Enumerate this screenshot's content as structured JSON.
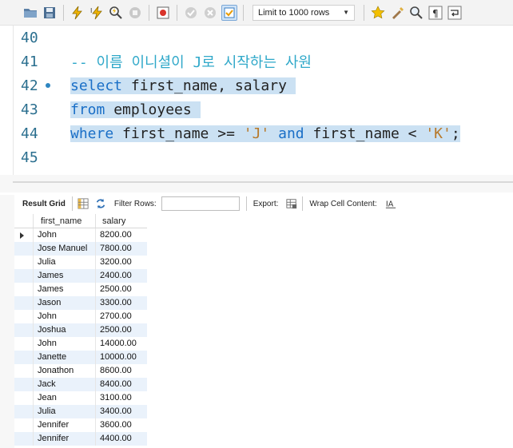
{
  "toolbar": {
    "limit_label": "Limit to 1000 rows",
    "icons": [
      "open-folder-icon",
      "save-icon",
      "execute-icon",
      "execute-current-icon",
      "explain-icon",
      "stop-icon",
      "toggle-error-icon",
      "commit-icon",
      "rollback-icon",
      "autocommit-icon",
      "bookmark-star-icon",
      "beautify-brush-icon",
      "find-icon",
      "invisible-chars-icon",
      "wrap-icon"
    ]
  },
  "editor": {
    "lines": [
      {
        "num": "40"
      },
      {
        "num": "41",
        "comment": "-- 이름 이니셜이 J로 시작하는 사원"
      },
      {
        "num": "42",
        "kw1": "select",
        "rest": " first_name, salary "
      },
      {
        "num": "43",
        "kw1": "from",
        "rest": " employees "
      },
      {
        "num": "44",
        "kw1": "where",
        "a": " first_name >= ",
        "s1": "'J'",
        "kw2": "and",
        "b": " first_name < ",
        "s2": "'K'",
        "c": ";"
      },
      {
        "num": "45"
      }
    ]
  },
  "result_toolbar": {
    "result_grid": "Result Grid",
    "filter_rows": "Filter Rows:",
    "filter_value": "",
    "export": "Export:",
    "wrap": "Wrap Cell Content:"
  },
  "grid": {
    "columns": [
      "first_name",
      "salary"
    ],
    "rows": [
      [
        "John",
        "8200.00"
      ],
      [
        "Jose Manuel",
        "7800.00"
      ],
      [
        "Julia",
        "3200.00"
      ],
      [
        "James",
        "2400.00"
      ],
      [
        "James",
        "2500.00"
      ],
      [
        "Jason",
        "3300.00"
      ],
      [
        "John",
        "2700.00"
      ],
      [
        "Joshua",
        "2500.00"
      ],
      [
        "John",
        "14000.00"
      ],
      [
        "Janette",
        "10000.00"
      ],
      [
        "Jonathon",
        "8600.00"
      ],
      [
        "Jack",
        "8400.00"
      ],
      [
        "Jean",
        "3100.00"
      ],
      [
        "Julia",
        "3400.00"
      ],
      [
        "Jennifer",
        "3600.00"
      ],
      [
        "Jennifer",
        "4400.00"
      ]
    ]
  },
  "colors": {
    "keyword": "#1a6fc7",
    "string": "#b7792b",
    "comment": "#2fa8c9",
    "selection": "#cbe1f3",
    "row_alt": "#eaf2fb"
  }
}
